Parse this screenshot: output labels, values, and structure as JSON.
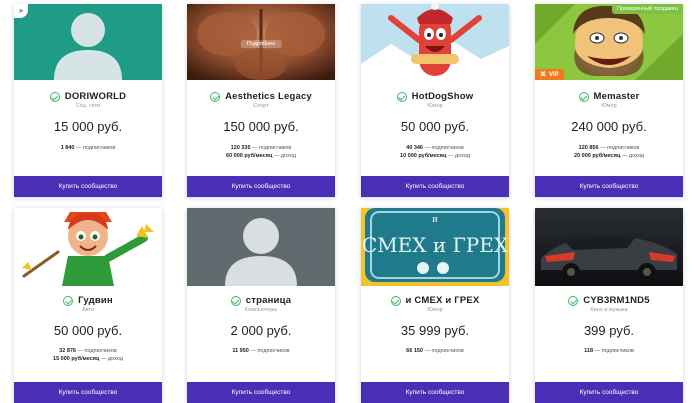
{
  "cards": [
    {
      "name": "DORIWORLD",
      "category": "Соц. сети",
      "price": "15 000 руб.",
      "subscribers": "1 840",
      "subscribers_label": "— подписчиков",
      "income": "",
      "income_label": "",
      "button": "Купить сообщество"
    },
    {
      "name": "Aesthetics Legacy",
      "category": "Спорт",
      "price": "150 000 руб.",
      "subscribers": "120 335",
      "subscribers_label": "— подписчиков",
      "income": "60 000 руб/месяц",
      "income_label": "— доход",
      "hover_label": "Подробнее",
      "button": "Купить сообщество"
    },
    {
      "name": "HotDogShow",
      "category": "Юмор",
      "price": "50 000 руб.",
      "subscribers": "40 346",
      "subscribers_label": "— подписчиков",
      "income": "10 000 руб/месяц",
      "income_label": "— доход",
      "button": "Купить сообщество"
    },
    {
      "name": "Memaster",
      "category": "Юмор",
      "price": "240 000 руб.",
      "subscribers": "120 856",
      "subscribers_label": "— подписчиков",
      "income": "20 000 руб/месяц",
      "income_label": "— доход",
      "verified_badge": "Проверенный продавец",
      "vip_badge": "VIP",
      "button": "Купить сообщество"
    },
    {
      "name": "Гудвин",
      "category": "Авто",
      "price": "50 000 руб.",
      "subscribers": "32 876",
      "subscribers_label": "— подписчиков",
      "income": "15 000 руб/месяц",
      "income_label": "— доход",
      "button": "Купить сообщество"
    },
    {
      "name": "страница",
      "category": "Компьютеры",
      "price": "2 000 руб.",
      "subscribers": "11 950",
      "subscribers_label": "— подписчиков",
      "income": "",
      "income_label": "",
      "button": "Купить сообщество"
    },
    {
      "name": "и СМЕХ и ГРЕХ",
      "category": "Юмор",
      "price": "35 999 руб.",
      "subscribers": "66 150",
      "subscribers_label": "— подписчиков",
      "income": "",
      "income_label": "",
      "image_text": "СМЕХ и ГРЕХ",
      "image_text_small": "и",
      "button": "Купить сообщество"
    },
    {
      "name": "CYB3RM1ND5",
      "category": "Кино и музыка",
      "price": "399 руб.",
      "subscribers": "118",
      "subscribers_label": "— подписчиков",
      "income": "",
      "income_label": "",
      "button": "Купить сообщество"
    }
  ],
  "colors": {
    "button_bg": "#4a2fb6",
    "verified_check": "#3fb56b",
    "verified_badge": "#7cc242",
    "vip_badge": "#f07a1e"
  }
}
